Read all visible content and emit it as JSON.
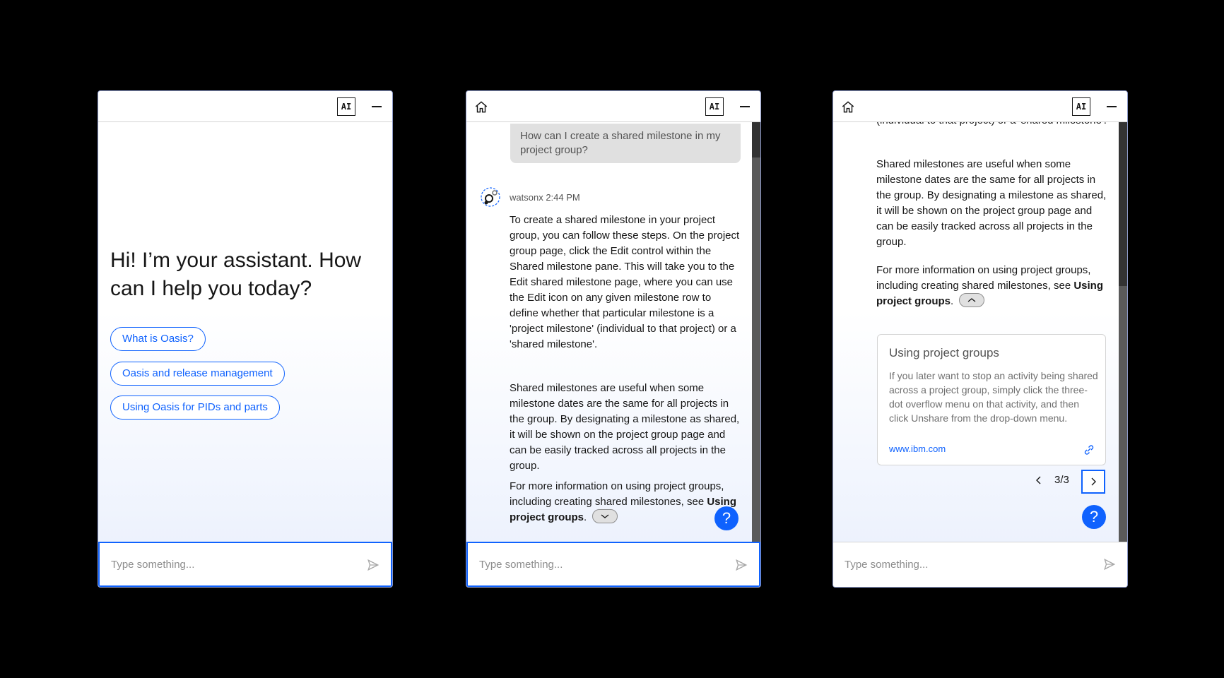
{
  "colors": {
    "background": "#000000",
    "accent": "#0f62fe",
    "panel_border": "#8d9ac9"
  },
  "panel1": {
    "ai_badge": "AI",
    "welcome": "Hi! I’m your assistant. How can I help you today?",
    "chips": [
      "What is Oasis?",
      "Oasis and release management",
      "Using Oasis for PIDs and parts"
    ],
    "input_placeholder": "Type something..."
  },
  "panel2": {
    "ai_badge": "AI",
    "user_message": "How can I create a shared milestone in my project group?",
    "sender": "watsonx",
    "time": "2:44 PM",
    "paragraph1": "To create a shared milestone in your project group, you can follow these steps. On the project group page, click the Edit control within the Shared milestone pane. This will take you to the Edit shared milestone page, where you can use the Edit icon on any given milestone row to define whether that particular milestone is a 'project milestone' (individual to that project) or a 'shared milestone'.",
    "paragraph2": "Shared milestones are useful when some milestone dates are the same for all projects in the group. By designating a milestone as shared, it will be shown on the project group page and can be easily tracked across all projects in the group.",
    "paragraph3": "For more information on using project groups, including creating shared milestones, see",
    "link_text": "Using project groups",
    "help_label": "?",
    "input_placeholder": "Type something..."
  },
  "panel3": {
    "ai_badge": "AI",
    "paragraph_top": "(individual to that project) or a 'shared milestone'.",
    "paragraph2": "Shared milestones are useful when some milestone dates are the same for all projects in the group. By designating a milestone as shared, it will be shown on the project group page and can be easily tracked across all projects in the group.",
    "paragraph3": "For more information on using project groups, including creating shared milestones, see",
    "link_text": "Using project groups",
    "source": {
      "title": "Using project groups",
      "body": "If you later want to stop an activity being shared across a project group, simply click the three-dot overflow menu on that activity, and then click Unshare from the drop-down menu.",
      "url": "www.ibm.com"
    },
    "pager": "3/3",
    "help_label": "?",
    "input_placeholder": "Type something..."
  }
}
